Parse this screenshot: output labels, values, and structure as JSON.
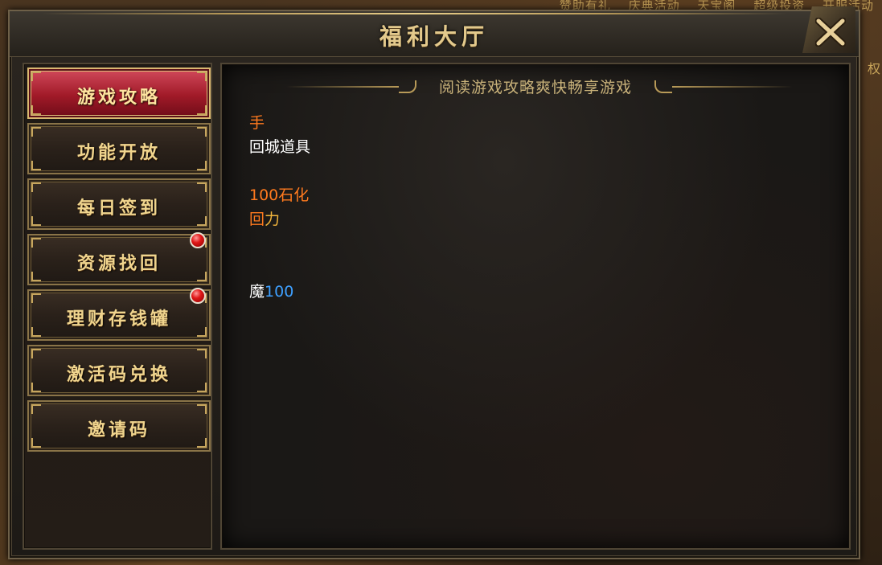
{
  "window": {
    "title": "福利大厅",
    "close_icon": "close-x-icon"
  },
  "background_hud": {
    "labels": [
      "赞助有礼",
      "庆典活动",
      "天宝阁",
      "超级投资",
      "开服活动"
    ],
    "side_label": "权"
  },
  "sidebar": {
    "items": [
      {
        "label": "游戏攻略",
        "active": true,
        "badge": false
      },
      {
        "label": "功能开放",
        "active": false,
        "badge": false
      },
      {
        "label": "每日签到",
        "active": false,
        "badge": false
      },
      {
        "label": "资源找回",
        "active": false,
        "badge": true
      },
      {
        "label": "理财存钱罐",
        "active": false,
        "badge": true
      },
      {
        "label": "激活码兑换",
        "active": false,
        "badge": false
      },
      {
        "label": "邀请码",
        "active": false,
        "badge": false
      }
    ]
  },
  "content": {
    "header": "阅读游戏攻略爽快畅享游戏",
    "lines": {
      "l1": {
        "a": "手"
      },
      "l2": {
        "a": "回城道具"
      },
      "l3": {
        "a": "100石化"
      },
      "l4": {
        "a": "回",
        "b": "力"
      },
      "l5": {
        "a": "魔",
        "b": "100"
      }
    }
  },
  "colors": {
    "accent_gold": "#e3c98c",
    "active_tab_red": "#a11a28",
    "text_orange": "#ff7a1e",
    "text_gold": "#f2b53c",
    "text_blue": "#3ea0ff",
    "badge_red": "#e01818"
  }
}
